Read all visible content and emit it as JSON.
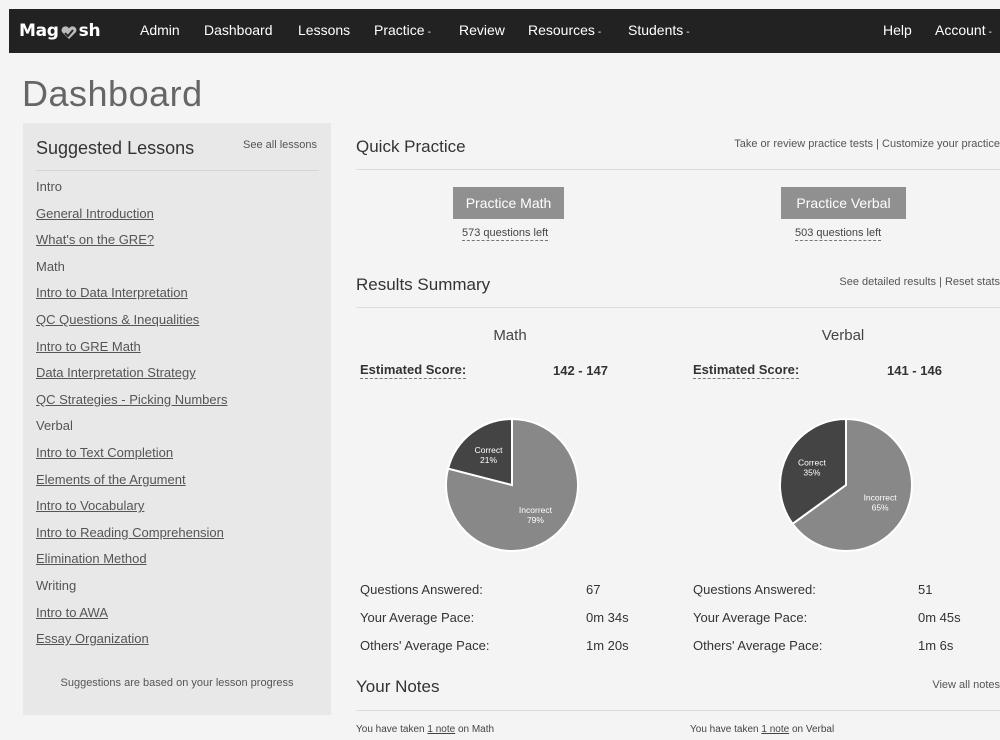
{
  "nav": {
    "logo_left": "Mag",
    "logo_right": "sh",
    "items": [
      "Admin",
      "Dashboard",
      "Lessons",
      "Practice",
      "Review",
      "Resources",
      "Students",
      "Help",
      "Account"
    ],
    "caret": "-"
  },
  "page_title": "Dashboard",
  "sidebar": {
    "title": "Suggested Lessons",
    "see_all": "See all lessons",
    "entries": [
      {
        "type": "section",
        "label": "Intro"
      },
      {
        "type": "lesson",
        "label": "General Introduction"
      },
      {
        "type": "lesson",
        "label": "What's on the GRE?"
      },
      {
        "type": "section",
        "label": "Math"
      },
      {
        "type": "lesson",
        "label": "Intro to Data Interpretation"
      },
      {
        "type": "lesson",
        "label": "QC Questions & Inequalities"
      },
      {
        "type": "lesson",
        "label": "Intro to GRE Math"
      },
      {
        "type": "lesson",
        "label": "Data Interpretation Strategy"
      },
      {
        "type": "lesson",
        "label": "QC Strategies - Picking Numbers"
      },
      {
        "type": "section",
        "label": "Verbal"
      },
      {
        "type": "lesson",
        "label": "Intro to Text Completion"
      },
      {
        "type": "lesson",
        "label": "Elements of the Argument"
      },
      {
        "type": "lesson",
        "label": "Intro to Vocabulary"
      },
      {
        "type": "lesson",
        "label": "Intro to Reading Comprehension"
      },
      {
        "type": "lesson",
        "label": "Elimination Method"
      },
      {
        "type": "section",
        "label": "Writing"
      },
      {
        "type": "lesson",
        "label": "Intro to AWA"
      },
      {
        "type": "lesson",
        "label": "Essay Organization"
      }
    ],
    "footer": "Suggestions are based on your lesson progress"
  },
  "quick_practice": {
    "title": "Quick Practice",
    "links": "Take or review practice tests | Customize your practice",
    "math_button": "Practice Math",
    "math_left": "573 questions left",
    "verbal_button": "Practice Verbal",
    "verbal_left": "503 questions left"
  },
  "results": {
    "title": "Results Summary",
    "links": "See detailed results | Reset stats",
    "est_label": "Estimated Score:",
    "math": {
      "heading": "Math",
      "score": "142 - 147",
      "correct_label": "Correct",
      "correct_pct": "21%",
      "incorrect_label": "Incorrect",
      "incorrect_pct": "79%",
      "correct_fraction": 0.21,
      "answered": "67",
      "your_pace": "0m 34s",
      "others_pace": "1m 20s"
    },
    "verbal": {
      "heading": "Verbal",
      "score": "141 - 146",
      "correct_label": "Correct",
      "correct_pct": "35%",
      "incorrect_label": "Incorrect",
      "incorrect_pct": "65%",
      "correct_fraction": 0.35,
      "answered": "51",
      "your_pace": "0m 45s",
      "others_pace": "1m 6s"
    },
    "stat_labels": [
      "Questions Answered:",
      "Your Average Pace:",
      "Others' Average Pace:"
    ]
  },
  "notes": {
    "title": "Your Notes",
    "view_all": "View all notes",
    "math_prefix": "You have taken ",
    "math_link": "1 note",
    "math_suffix": " on Math",
    "verbal_prefix": "You have taken ",
    "verbal_link": "1 note",
    "verbal_suffix": " on Verbal"
  },
  "colors": {
    "correct": "#444444",
    "incorrect": "#888888",
    "pie_border": "#ffffff"
  }
}
